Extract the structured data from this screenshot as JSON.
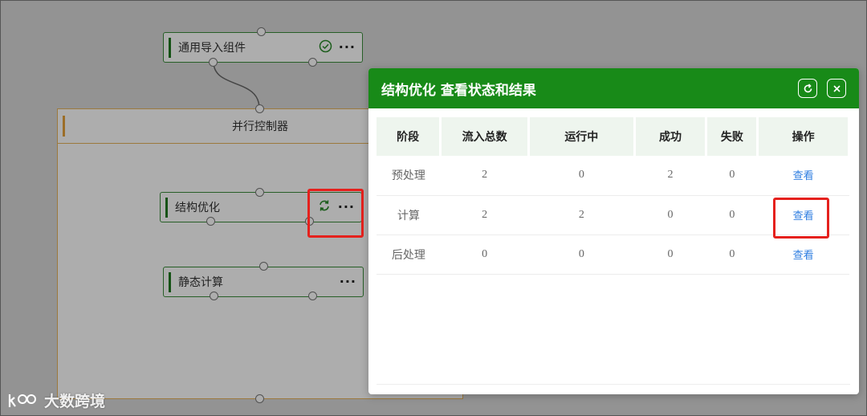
{
  "canvas": {
    "top_node": {
      "label": "通用导入组件",
      "status_icon": "check-circle-icon",
      "menu": "···"
    },
    "group": {
      "title": "并行控制器"
    },
    "node_structure": {
      "label": "结构优化",
      "status_icon": "refresh-cycle-icon",
      "menu": "···"
    },
    "node_static": {
      "label": "静态计算",
      "menu": "···"
    }
  },
  "modal": {
    "title": "结构优化 查看状态和结果",
    "refresh_icon": "refresh-icon",
    "close_icon": "close-icon",
    "columns": [
      "阶段",
      "流入总数",
      "运行中",
      "成功",
      "失败",
      "操作"
    ],
    "rows": [
      {
        "stage": "预处理",
        "inflow": "2",
        "running": "0",
        "success": "2",
        "failed": "0",
        "action": "查看"
      },
      {
        "stage": "计算",
        "inflow": "2",
        "running": "2",
        "success": "0",
        "failed": "0",
        "action": "查看"
      },
      {
        "stage": "后处理",
        "inflow": "0",
        "running": "0",
        "success": "0",
        "failed": "0",
        "action": "查看"
      }
    ]
  },
  "watermark": {
    "text": "大数跨境"
  },
  "colors": {
    "header_green": "#188a18",
    "highlight_red": "#e5211d",
    "link_blue": "#2e7de0",
    "group_border": "#e6b35a"
  }
}
